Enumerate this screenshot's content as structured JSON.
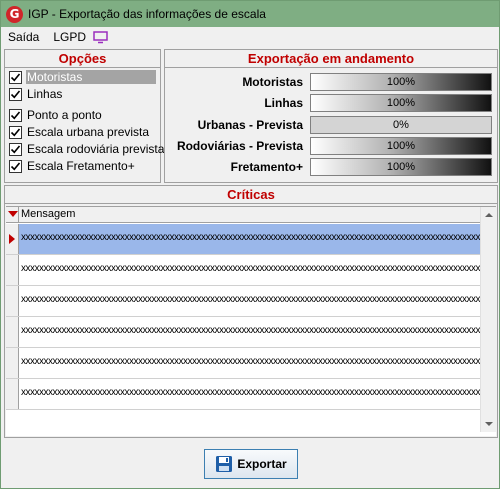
{
  "window": {
    "title": "IGP - Exportação das informações de escala",
    "app_icon": "G"
  },
  "menu": [
    {
      "label": "Saída"
    },
    {
      "label": "LGPD"
    }
  ],
  "colors": {
    "titlebar": "#7fae83",
    "section_header": "#c00000",
    "selection": "#9ab7ea"
  },
  "options": {
    "header": "Opções",
    "items": [
      {
        "label": "Motoristas",
        "checked": true,
        "selected": true
      },
      {
        "label": "Linhas",
        "checked": true
      },
      {
        "label": "Ponto a ponto",
        "checked": true
      },
      {
        "label": "Escala urbana prevista",
        "checked": true
      },
      {
        "label": "Escala rodoviária prevista",
        "checked": true
      },
      {
        "label": "Escala Fretamento+",
        "checked": true
      }
    ]
  },
  "export": {
    "header": "Exportação em andamento",
    "rows": [
      {
        "label": "Motoristas",
        "percent_text": "100%",
        "fraction": 1.0
      },
      {
        "label": "Linhas",
        "percent_text": "100%",
        "fraction": 1.0
      },
      {
        "label": "Urbanas - Prevista",
        "percent_text": "0%",
        "fraction": 0.0
      },
      {
        "label": "Rodoviárias - Prevista",
        "percent_text": "100%",
        "fraction": 1.0
      },
      {
        "label": "Fretamento+",
        "percent_text": "100%",
        "fraction": 1.0
      }
    ]
  },
  "criticas": {
    "header": "Críticas",
    "column": "Mensagem",
    "rows": [
      {
        "text": "xxxxxxxxxxxxxxxxxxxxxxxxxxxxxxxxxxxxxxxxxxxxxxxxxxxxxxxxxxxxxxxxxxxxxxxxxxxxxxxxxxxxxxxxxxxxxxxxxxxxxxxxxxxxxxxxxxxxxxxxxxxxxxxxxxxxxxxxxxxxxxxxxx",
        "selected": true
      },
      {
        "text": "xxxxxxxxxxxxxxxxxxxxxxxxxxxxxxxxxxxxxxxxxxxxxxxxxxxxxxxxxxxxxxxxxxxxxxxxxxxxxxxxxxxxxxxxxxxxxxxxxxxxxxxxxxxxxxxxxxxxxxxxxxxxxxxxxxxxxxxxxxxxxxxxxx"
      },
      {
        "text": "xxxxxxxxxxxxxxxxxxxxxxxxxxxxxxxxxxxxxxxxxxxxxxxxxxxxxxxxxxxxxxxxxxxxxxxxxxxxxxxxxxxxxxxxxxxxxxxxxxxxxxxxxxxxxxxxxxxxxxxxxxxxxxxxxxxxxxxxxxxxxxxx"
      },
      {
        "text": "xxxxxxxxxxxxxxxxxxxxxxxxxxxxxxxxxxxxxxxxxxxxxxxxxxxxxxxxxxxxxxxxxxxxxxxxxxxxxxxxxxxxxxxxxxxxxxxxxxxxxxxxxxxxxxxxxxxxxxxxxxxxxxxxxx"
      },
      {
        "text": "xxxxxxxxxxxxxxxxxxxxxxxxxxxxxxxxxxxxxxxxxxxxxxxxxxxxxxxxxxxxxxxxxxxxxxxxxxxxxxxxxxxxxxxxxxxxxxxxxxxxxxxxxxxxxxxxxxxxxxxxxxxxxxxxxx"
      },
      {
        "text": "xxxxxxxxxxxxxxxxxxxxxxxxxxxxxxxxxxxxxxxxxxxxxxxxxxxxxxxxxxxxxxxxxxxxxxxxxxxxxxxxxxxxxxxxxxxxxxxxxxxxxxxxxxxxxxxxxxxxxxxxxxxxxxxxxxxxxxxxxxxxxx"
      }
    ]
  },
  "footer": {
    "export_button": "Exportar",
    "export_icon": "save-icon"
  }
}
